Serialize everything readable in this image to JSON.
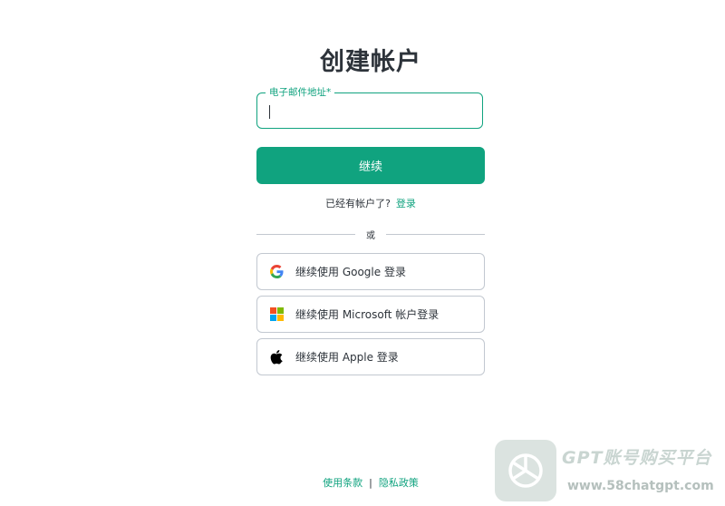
{
  "page": {
    "title": "创建帐户"
  },
  "email": {
    "label": "电子邮件地址*",
    "value": ""
  },
  "continue_button": {
    "label": "继续"
  },
  "login_prompt": {
    "text": "已经有帐户了?",
    "link_label": "登录"
  },
  "divider": {
    "text": "或"
  },
  "social": {
    "google": {
      "label": "继续使用 Google 登录",
      "icon": "google-icon"
    },
    "microsoft": {
      "label": "继续使用 Microsoft 帐户登录",
      "icon": "microsoft-icon"
    },
    "apple": {
      "label": "继续使用 Apple 登录",
      "icon": "apple-icon"
    }
  },
  "footer": {
    "terms": "使用条款",
    "separator": "|",
    "privacy": "隐私政策"
  },
  "watermark": {
    "title": "GPT账号购买平台",
    "url": "www.58chatgpt.com"
  },
  "colors": {
    "accent": "#10a37f",
    "text": "#2d333a",
    "border": "#c2c8d0"
  }
}
